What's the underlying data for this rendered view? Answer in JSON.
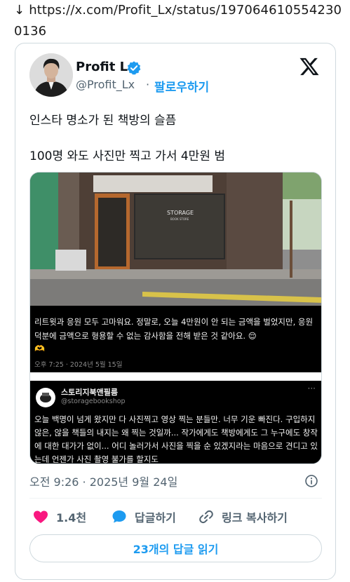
{
  "header": {
    "arrow": "↓",
    "url": "https://x.com/Profit_Lx/status/1970646105542300136"
  },
  "author": {
    "name": "Profit L",
    "handle": "@Profit_Lx",
    "separator": "·",
    "follow_label": "팔로우하기"
  },
  "tweet": {
    "line1": "인스타 명소가 된 책방의 슬픔",
    "line2": "100명 와도 사진만 찍고 가서 4만원 범"
  },
  "media": {
    "storefront_sign": "STORAGE",
    "storefront_sub": "BOOK STORE",
    "story_text": "리트윗과 응원 모두 고마워요. 정말로, 오늘 4만원이 안 되는 금액을 벌었지만, 응원 덕분에 금액으로 형용할 수 없는 감사함을 전해 받은 것 같아요. 😌",
    "story_emoji": "🫶",
    "story_meta": "오후 7:25 · 2024년 5월 15일",
    "shop_name": "스토리지북앤필름",
    "shop_handle": "@storagebookshop",
    "shop_more": "···",
    "shop_text": "오늘 백명이 넘게 왔지만 다 사진찍고 영상 찍는 분들만. 너무 기운 빠진다. 구입하지 않은, 않을 책들의 내지는 왜 찍는 것일까... 작가에게도 책방에게도 그 누구에도 창작에 대한 대가가 없이... 어디 놀러가서 사진을 찍을 순 있겠지라는 마음으로 견디고 있는데 언젠가 사진 촬영 불가를 할지도"
  },
  "footer": {
    "timestamp": "오전 9:26 · 2025년 9월 24일",
    "likes": "1.4천",
    "reply_label": "답글하기",
    "copy_label": "링크 복사하기",
    "read_replies": "23개의 답글 읽기"
  },
  "colors": {
    "accent": "#1d9bf0",
    "like": "#f91880",
    "text": "#0f1419",
    "muted": "#536471"
  }
}
